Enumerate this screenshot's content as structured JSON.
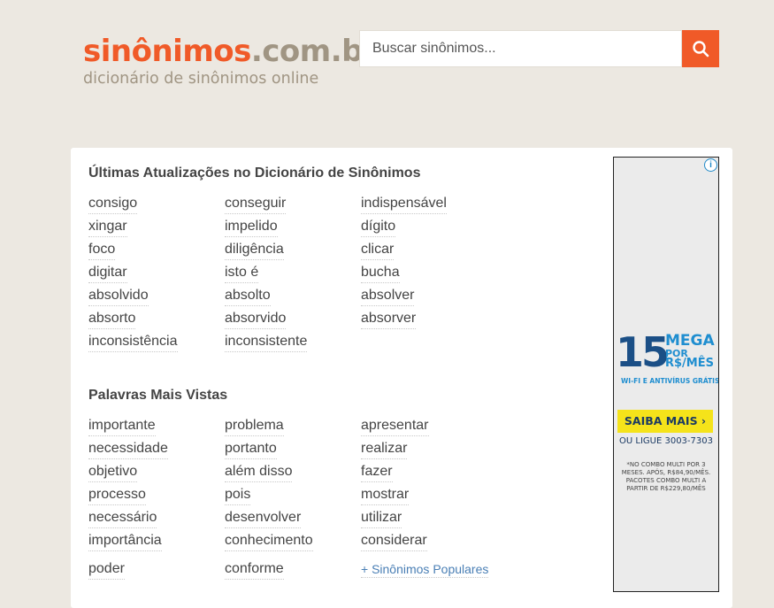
{
  "header": {
    "logo_main": "sinônimos",
    "logo_domain": ".com.br",
    "logo_tagline": "dicionário de sinônimos online"
  },
  "search": {
    "placeholder": "Buscar sinônimos...",
    "value": "",
    "button_icon": "search-icon"
  },
  "updates": {
    "title": "Últimas Atualizações no Dicionário de Sinônimos",
    "columns": [
      [
        "consigo",
        "xingar",
        "foco",
        "digitar",
        "absolvido",
        "absorto",
        "inconsistência"
      ],
      [
        "conseguir",
        "impelido",
        "diligência",
        "isto é",
        "absolto",
        "absorvido",
        "inconsistente"
      ],
      [
        "indispensável",
        "dígito",
        "clicar",
        "bucha",
        "absolver",
        "absorver"
      ]
    ]
  },
  "popular": {
    "title": "Palavras Mais Vistas",
    "columns": [
      [
        "importante",
        "necessidade",
        "objetivo",
        "processo",
        "necessário",
        "importância",
        "poder"
      ],
      [
        "problema",
        "portanto",
        "além disso",
        "pois",
        "desenvolver",
        "conhecimento",
        "conforme"
      ],
      [
        "apresentar",
        "realizar",
        "fazer",
        "mostrar",
        "utilizar",
        "considerar"
      ]
    ],
    "more_link": "+ Sinônimos Populares"
  },
  "ad": {
    "info_icon": "info-icon",
    "number": "15",
    "mega": "MEGA",
    "por": "POR",
    "price": "R$/MÊS",
    "wifi": "WI-FI E ANTIVÍRUS GRÁTIS",
    "cta": "SAIBA MAIS ›",
    "call": "OU LIGUE 3003-7303",
    "fine_print": "*NO COMBO MULTI POR 3 MESES. APÓS, R$84,90/MÊS. PACOTES COMBO MULTI A PARTIR DE R$229,80/MÊS"
  },
  "colors": {
    "accent": "#f05a28",
    "logo_secondary": "#a09583",
    "page_bg": "#ece8e1",
    "link_blue": "#4a7fb5"
  }
}
